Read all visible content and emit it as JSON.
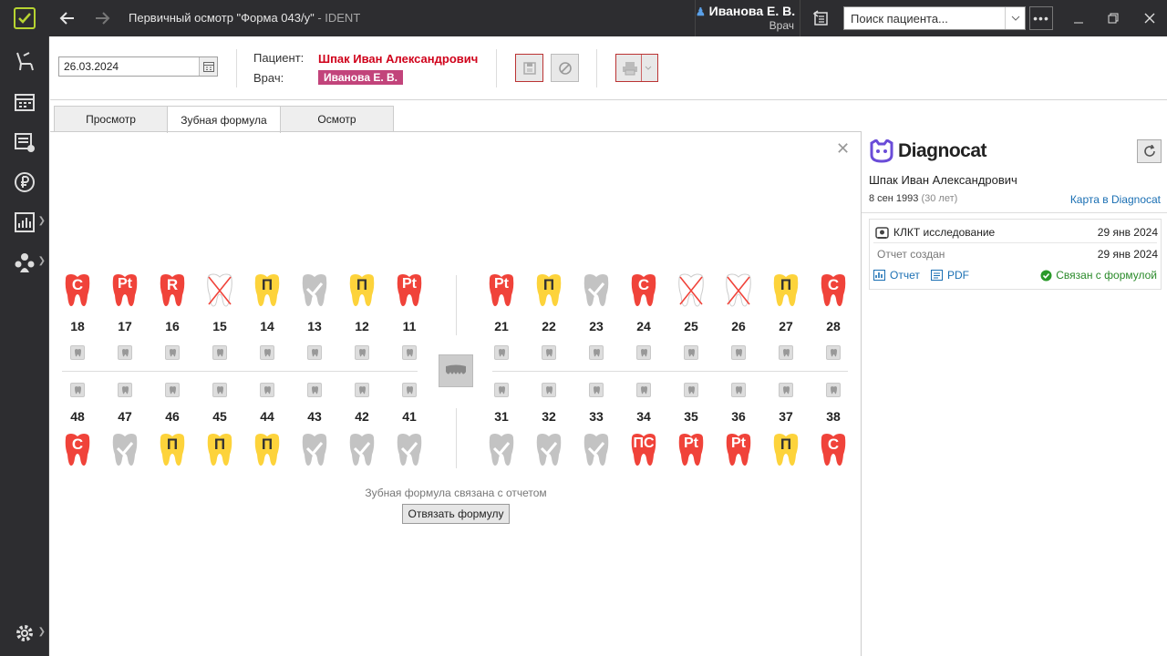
{
  "window": {
    "title": "Первичный осмотр \"Форма 043/у\"",
    "app_suffix": " - IDENT"
  },
  "user": {
    "name": "Иванова Е. В.",
    "role": "Врач"
  },
  "search": {
    "placeholder": "Поиск пациента..."
  },
  "toppanel": {
    "date": "26.03.2024",
    "patient_label": "Пациент:",
    "patient_name": "Шпак Иван Александрович",
    "doctor_label": "Врач:",
    "doctor_name": "Иванова Е. В."
  },
  "tabs": [
    {
      "label": "Просмотр"
    },
    {
      "label": "Зубная формула"
    },
    {
      "label": "Осмотр"
    }
  ],
  "teeth_upper_left": [
    {
      "num": "18",
      "mark": "C",
      "color": "red"
    },
    {
      "num": "17",
      "mark": "Pt",
      "color": "red"
    },
    {
      "num": "16",
      "mark": "R",
      "color": "red"
    },
    {
      "num": "15",
      "mark": "",
      "color": "missing"
    },
    {
      "num": "14",
      "mark": "П",
      "color": "yellow"
    },
    {
      "num": "13",
      "mark": "",
      "color": "gray"
    },
    {
      "num": "12",
      "mark": "П",
      "color": "yellow"
    },
    {
      "num": "11",
      "mark": "Pt",
      "color": "red"
    }
  ],
  "teeth_upper_right": [
    {
      "num": "21",
      "mark": "Pt",
      "color": "red"
    },
    {
      "num": "22",
      "mark": "П",
      "color": "yellow"
    },
    {
      "num": "23",
      "mark": "",
      "color": "gray"
    },
    {
      "num": "24",
      "mark": "C",
      "color": "red"
    },
    {
      "num": "25",
      "mark": "",
      "color": "missing"
    },
    {
      "num": "26",
      "mark": "",
      "color": "missing"
    },
    {
      "num": "27",
      "mark": "П",
      "color": "yellow"
    },
    {
      "num": "28",
      "mark": "C",
      "color": "red"
    }
  ],
  "teeth_lower_left": [
    {
      "num": "48",
      "mark": "C",
      "color": "red"
    },
    {
      "num": "47",
      "mark": "",
      "color": "gray"
    },
    {
      "num": "46",
      "mark": "П",
      "color": "yellow"
    },
    {
      "num": "45",
      "mark": "П",
      "color": "yellow"
    },
    {
      "num": "44",
      "mark": "П",
      "color": "yellow"
    },
    {
      "num": "43",
      "mark": "",
      "color": "gray"
    },
    {
      "num": "42",
      "mark": "",
      "color": "gray"
    },
    {
      "num": "41",
      "mark": "",
      "color": "gray"
    }
  ],
  "teeth_lower_right": [
    {
      "num": "31",
      "mark": "",
      "color": "gray"
    },
    {
      "num": "32",
      "mark": "",
      "color": "gray"
    },
    {
      "num": "33",
      "mark": "",
      "color": "gray"
    },
    {
      "num": "34",
      "mark": "ПС",
      "color": "red"
    },
    {
      "num": "35",
      "mark": "Pt",
      "color": "red"
    },
    {
      "num": "36",
      "mark": "Pt",
      "color": "red"
    },
    {
      "num": "37",
      "mark": "П",
      "color": "yellow"
    },
    {
      "num": "38",
      "mark": "C",
      "color": "red"
    }
  ],
  "formula": {
    "link_info": "Зубная формула связана с отчетом",
    "unlink_button": "Отвязать формулу"
  },
  "diagnocat": {
    "brand": "Diagnocat",
    "patient_name": "Шпак Иван Александрович",
    "dob": "8 сен 1993",
    "age": "(30 лет)",
    "card_link": "Карта в Diagnocat",
    "study": {
      "title": "КЛКТ исследование",
      "date": "29 янв 2024",
      "report_label": "Отчет создан",
      "report_date": "29 янв 2024",
      "report_link": "Отчет",
      "pdf_link": "PDF",
      "status": "Связан с формулой"
    }
  },
  "colors": {
    "red": "#f0433a",
    "yellow": "#fdd33b",
    "gray": "#c3c3c3",
    "accent": "#b7d431"
  }
}
